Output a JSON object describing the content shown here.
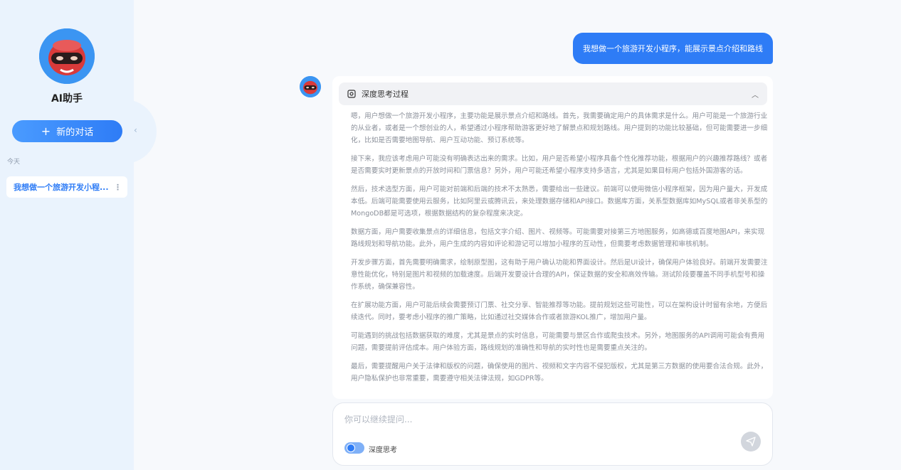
{
  "sidebar": {
    "app_name": "AI助手",
    "new_chat_label": "新的对话",
    "section_label": "今天",
    "history": [
      {
        "title": "我想做一个旅游开发小程..."
      }
    ],
    "more_icon": "⋮",
    "collapse_icon": "‹"
  },
  "chat": {
    "user_message": "我想做一个旅游开发小程序，能展示景点介绍和路线",
    "thinking_title": "深度思考过程",
    "thinking_paragraphs": [
      "嗯，用户想做一个旅游开发小程序，主要功能是展示景点介绍和路线。首先，我需要确定用户的具体需求是什么。用户可能是一个旅游行业的从业者，或者是一个想创业的人，希望通过小程序帮助游客更好地了解景点和规划路线。用户提到的功能比较基础，但可能需要进一步细化，比如是否需要地图导航、用户互动功能、预订系统等。",
      "接下来，我应该考虑用户可能没有明确表达出来的需求。比如，用户是否希望小程序具备个性化推荐功能，根据用户的兴趣推荐路线？或者是否需要实时更新景点的开放时间和门票信息？另外，用户可能还希望小程序支持多语言，尤其是如果目标用户包括外国游客的话。",
      "然后，技术选型方面，用户可能对前端和后端的技术不太熟悉，需要给出一些建议。前端可以使用微信小程序框架，因为用户量大，开发成本低。后端可能需要使用云服务，比如阿里云或腾讯云，来处理数据存储和API接口。数据库方面，关系型数据库如MySQL或者非关系型的MongoDB都是可选项，根据数据结构的复杂程度来决定。",
      "数据方面，用户需要收集景点的详细信息，包括文字介绍、图片、视频等。可能需要对接第三方地图服务，如高德或百度地图API，来实现路线规划和导航功能。此外，用户生成的内容如评论和游记可以增加小程序的互动性，但需要考虑数据管理和审核机制。",
      "开发步骤方面，首先需要明确需求，绘制原型图，这有助于用户确认功能和界面设计。然后是UI设计，确保用户体验良好。前端开发需要注意性能优化，特别是图片和视频的加载速度。后端开发要设计合理的API，保证数据的安全和高效传输。测试阶段要覆盖不同手机型号和操作系统，确保兼容性。",
      "在扩展功能方面，用户可能后续会需要预订门票、社交分享、智能推荐等功能。提前规划这些可能性，可以在架构设计时留有余地，方便后续迭代。同时，要考虑小程序的推广策略，比如通过社交媒体合作或者旅游KOL推广，增加用户量。",
      "可能遇到的挑战包括数据获取的难度，尤其是景点的实时信息，可能需要与景区合作或爬虫技术。另外，地图服务的API调用可能会有费用问题，需要提前评估成本。用户体验方面，路线规划的准确性和导航的实时性也是需要重点关注的。",
      "最后，需要提醒用户关于法律和版权的问题，确保使用的图片、视频和文字内容不侵犯版权，尤其是第三方数据的使用要合法合规。此外，用户隐私保护也非常重要，需要遵守相关法律法规，如GDPR等。"
    ]
  },
  "composer": {
    "placeholder": "你可以继续提问...",
    "deep_think_label": "深度思考",
    "deep_think_enabled": true
  },
  "colors": {
    "accent": "#2e7cf6",
    "sidebar_bg": "#eaf3fd",
    "page_bg": "#f7f9fc"
  },
  "icons": {
    "avatar": "robot-avatar-icon",
    "brain": "brain-icon",
    "chevron": "chevron-up-icon",
    "send": "send-icon",
    "plus": "plus-icon"
  }
}
